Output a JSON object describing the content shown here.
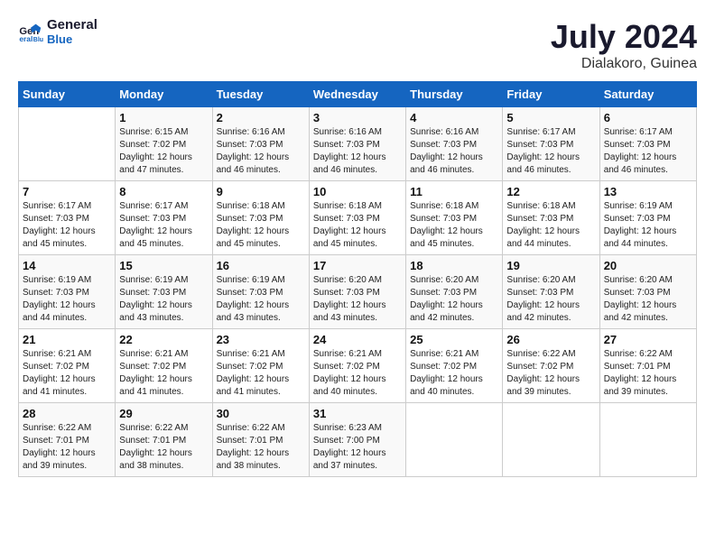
{
  "header": {
    "logo_line1": "General",
    "logo_line2": "Blue",
    "title": "July 2024",
    "subtitle": "Dialakoro, Guinea"
  },
  "weekdays": [
    "Sunday",
    "Monday",
    "Tuesday",
    "Wednesday",
    "Thursday",
    "Friday",
    "Saturday"
  ],
  "weeks": [
    [
      {
        "day": "",
        "info": ""
      },
      {
        "day": "1",
        "info": "Sunrise: 6:15 AM\nSunset: 7:02 PM\nDaylight: 12 hours\nand 47 minutes."
      },
      {
        "day": "2",
        "info": "Sunrise: 6:16 AM\nSunset: 7:03 PM\nDaylight: 12 hours\nand 46 minutes."
      },
      {
        "day": "3",
        "info": "Sunrise: 6:16 AM\nSunset: 7:03 PM\nDaylight: 12 hours\nand 46 minutes."
      },
      {
        "day": "4",
        "info": "Sunrise: 6:16 AM\nSunset: 7:03 PM\nDaylight: 12 hours\nand 46 minutes."
      },
      {
        "day": "5",
        "info": "Sunrise: 6:17 AM\nSunset: 7:03 PM\nDaylight: 12 hours\nand 46 minutes."
      },
      {
        "day": "6",
        "info": "Sunrise: 6:17 AM\nSunset: 7:03 PM\nDaylight: 12 hours\nand 46 minutes."
      }
    ],
    [
      {
        "day": "7",
        "info": "Sunrise: 6:17 AM\nSunset: 7:03 PM\nDaylight: 12 hours\nand 45 minutes."
      },
      {
        "day": "8",
        "info": "Sunrise: 6:17 AM\nSunset: 7:03 PM\nDaylight: 12 hours\nand 45 minutes."
      },
      {
        "day": "9",
        "info": "Sunrise: 6:18 AM\nSunset: 7:03 PM\nDaylight: 12 hours\nand 45 minutes."
      },
      {
        "day": "10",
        "info": "Sunrise: 6:18 AM\nSunset: 7:03 PM\nDaylight: 12 hours\nand 45 minutes."
      },
      {
        "day": "11",
        "info": "Sunrise: 6:18 AM\nSunset: 7:03 PM\nDaylight: 12 hours\nand 45 minutes."
      },
      {
        "day": "12",
        "info": "Sunrise: 6:18 AM\nSunset: 7:03 PM\nDaylight: 12 hours\nand 44 minutes."
      },
      {
        "day": "13",
        "info": "Sunrise: 6:19 AM\nSunset: 7:03 PM\nDaylight: 12 hours\nand 44 minutes."
      }
    ],
    [
      {
        "day": "14",
        "info": "Sunrise: 6:19 AM\nSunset: 7:03 PM\nDaylight: 12 hours\nand 44 minutes."
      },
      {
        "day": "15",
        "info": "Sunrise: 6:19 AM\nSunset: 7:03 PM\nDaylight: 12 hours\nand 43 minutes."
      },
      {
        "day": "16",
        "info": "Sunrise: 6:19 AM\nSunset: 7:03 PM\nDaylight: 12 hours\nand 43 minutes."
      },
      {
        "day": "17",
        "info": "Sunrise: 6:20 AM\nSunset: 7:03 PM\nDaylight: 12 hours\nand 43 minutes."
      },
      {
        "day": "18",
        "info": "Sunrise: 6:20 AM\nSunset: 7:03 PM\nDaylight: 12 hours\nand 42 minutes."
      },
      {
        "day": "19",
        "info": "Sunrise: 6:20 AM\nSunset: 7:03 PM\nDaylight: 12 hours\nand 42 minutes."
      },
      {
        "day": "20",
        "info": "Sunrise: 6:20 AM\nSunset: 7:03 PM\nDaylight: 12 hours\nand 42 minutes."
      }
    ],
    [
      {
        "day": "21",
        "info": "Sunrise: 6:21 AM\nSunset: 7:02 PM\nDaylight: 12 hours\nand 41 minutes."
      },
      {
        "day": "22",
        "info": "Sunrise: 6:21 AM\nSunset: 7:02 PM\nDaylight: 12 hours\nand 41 minutes."
      },
      {
        "day": "23",
        "info": "Sunrise: 6:21 AM\nSunset: 7:02 PM\nDaylight: 12 hours\nand 41 minutes."
      },
      {
        "day": "24",
        "info": "Sunrise: 6:21 AM\nSunset: 7:02 PM\nDaylight: 12 hours\nand 40 minutes."
      },
      {
        "day": "25",
        "info": "Sunrise: 6:21 AM\nSunset: 7:02 PM\nDaylight: 12 hours\nand 40 minutes."
      },
      {
        "day": "26",
        "info": "Sunrise: 6:22 AM\nSunset: 7:02 PM\nDaylight: 12 hours\nand 39 minutes."
      },
      {
        "day": "27",
        "info": "Sunrise: 6:22 AM\nSunset: 7:01 PM\nDaylight: 12 hours\nand 39 minutes."
      }
    ],
    [
      {
        "day": "28",
        "info": "Sunrise: 6:22 AM\nSunset: 7:01 PM\nDaylight: 12 hours\nand 39 minutes."
      },
      {
        "day": "29",
        "info": "Sunrise: 6:22 AM\nSunset: 7:01 PM\nDaylight: 12 hours\nand 38 minutes."
      },
      {
        "day": "30",
        "info": "Sunrise: 6:22 AM\nSunset: 7:01 PM\nDaylight: 12 hours\nand 38 minutes."
      },
      {
        "day": "31",
        "info": "Sunrise: 6:23 AM\nSunset: 7:00 PM\nDaylight: 12 hours\nand 37 minutes."
      },
      {
        "day": "",
        "info": ""
      },
      {
        "day": "",
        "info": ""
      },
      {
        "day": "",
        "info": ""
      }
    ]
  ]
}
